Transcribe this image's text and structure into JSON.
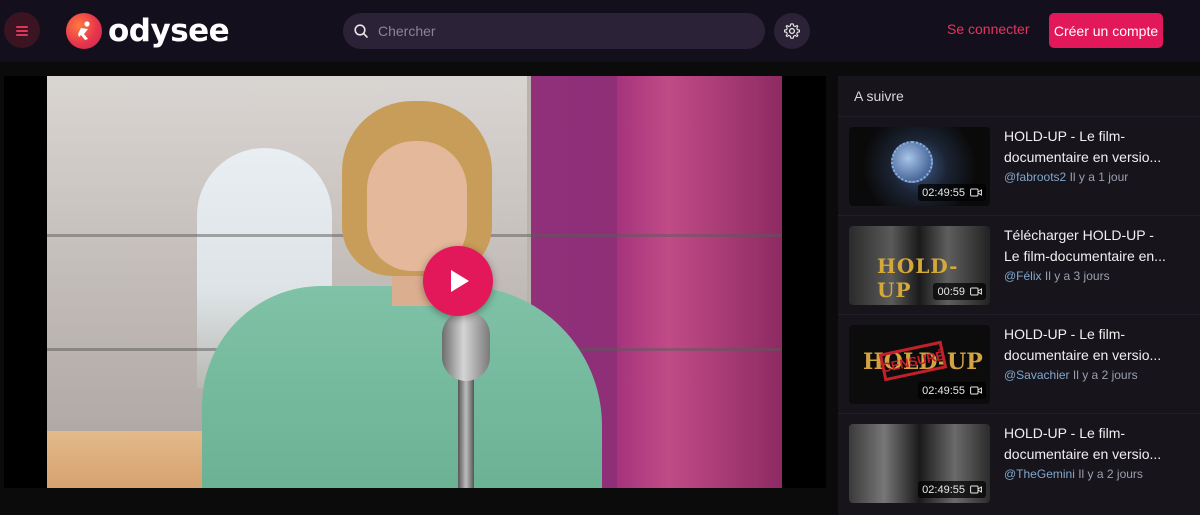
{
  "header": {
    "logo_text": "odysee",
    "search_placeholder": "Chercher",
    "signin_label": "Se connecter",
    "signup_label": "Créer un compte"
  },
  "colors": {
    "accent": "#e2185b",
    "header_bg": "#140f1d",
    "sidebar_bg": "#17141c",
    "channel_text": "#7fa8cc"
  },
  "player": {
    "state": "paused"
  },
  "sidebar": {
    "title": "A suivre",
    "items": [
      {
        "title_l1": "HOLD-UP - Le film-",
        "title_l2": "documentaire en versio...",
        "channel": "@fabroots2",
        "time": "Il y a 1 jour",
        "duration": "02:49:55"
      },
      {
        "title_l1": "Télécharger HOLD-UP -",
        "title_l2": "Le film-documentaire en...",
        "channel": "@Félix",
        "time": "Il y a 3 jours",
        "duration": "00:59",
        "thumb_text": "HOLD-UP"
      },
      {
        "title_l1": "HOLD-UP - Le film-",
        "title_l2": "documentaire en versio...",
        "channel": "@Savachier",
        "time": "Il y a 2 jours",
        "duration": "02:49:55",
        "thumb_text": "HOLD-UP",
        "thumb_stamp": "CENSURÉ"
      },
      {
        "title_l1": "HOLD-UP - Le film-",
        "title_l2": "documentaire en versio...",
        "channel": "@TheGemini",
        "time": "Il y a 2 jours",
        "duration": "02:49:55"
      }
    ]
  }
}
